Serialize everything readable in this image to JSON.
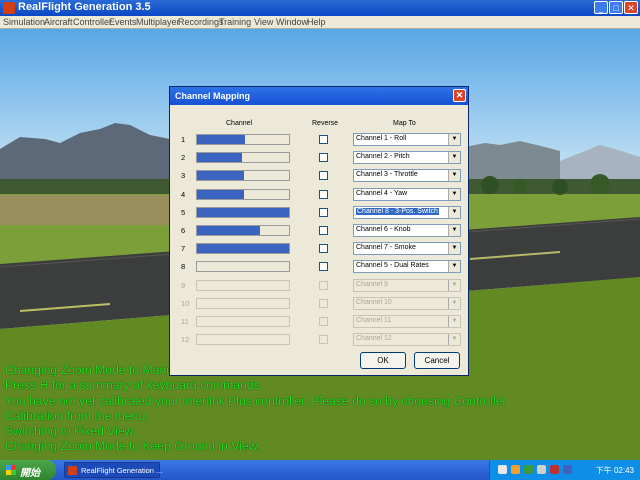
{
  "window": {
    "title": "RealFlight Generation 3.5"
  },
  "menu": [
    "Simulation",
    "Aircraft",
    "Controller",
    "Events",
    "Multiplayer",
    "Recordings",
    "Training",
    "View",
    "Window",
    "Help"
  ],
  "dialog": {
    "title": "Channel Mapping",
    "headers": {
      "channel": "Channel",
      "reverse": "Reverse",
      "mapto": "Map To"
    },
    "rows": [
      {
        "num": "1",
        "level": 0.52,
        "enabled": true,
        "highlighted": false,
        "map": "Channel 1 - Roll"
      },
      {
        "num": "2",
        "level": 0.49,
        "enabled": true,
        "highlighted": false,
        "map": "Channel 2 - Pitch"
      },
      {
        "num": "3",
        "level": 0.51,
        "enabled": true,
        "highlighted": false,
        "map": "Channel 3 - Throttle"
      },
      {
        "num": "4",
        "level": 0.51,
        "enabled": true,
        "highlighted": false,
        "map": "Channel 4 - Yaw"
      },
      {
        "num": "5",
        "level": 1.0,
        "enabled": true,
        "highlighted": true,
        "map": "Channel 8 - 3-Pos. Switch"
      },
      {
        "num": "6",
        "level": 0.68,
        "enabled": true,
        "highlighted": false,
        "map": "Channel 6 - Knob"
      },
      {
        "num": "7",
        "level": 1.0,
        "enabled": true,
        "highlighted": false,
        "map": "Channel 7 - Smoke"
      },
      {
        "num": "8",
        "level": 0.0,
        "enabled": true,
        "highlighted": false,
        "map": "Channel 5 - Dual Rates"
      },
      {
        "num": "9",
        "level": 0.0,
        "enabled": false,
        "highlighted": false,
        "map": "Channel 9"
      },
      {
        "num": "10",
        "level": 0.0,
        "enabled": false,
        "highlighted": false,
        "map": "Channel 10"
      },
      {
        "num": "11",
        "level": 0.0,
        "enabled": false,
        "highlighted": false,
        "map": "Channel 11"
      },
      {
        "num": "12",
        "level": 0.0,
        "enabled": false,
        "highlighted": false,
        "map": "Channel 12"
      }
    ],
    "ok_label": "OK",
    "cancel_label": "Cancel"
  },
  "messages": [
    "Changing Zoom Mode to Manual.",
    "Press H for a summary of keyboard commands.",
    "You have not yet calibrated your Interlink Plus controller.  Please do so by choosing Controller",
    "Calibration from the menu.",
    "Switching to Fixed View.",
    "Changing Zoom Mode to Keep Ground in View."
  ],
  "taskbar": {
    "start_label": "開始",
    "task_label": "RealFlight Generation ...",
    "clock": "下午 02:43"
  },
  "colors": {
    "message": "#21e121",
    "bar_fill": "#3a64c0",
    "highlight": "#316ac5"
  }
}
